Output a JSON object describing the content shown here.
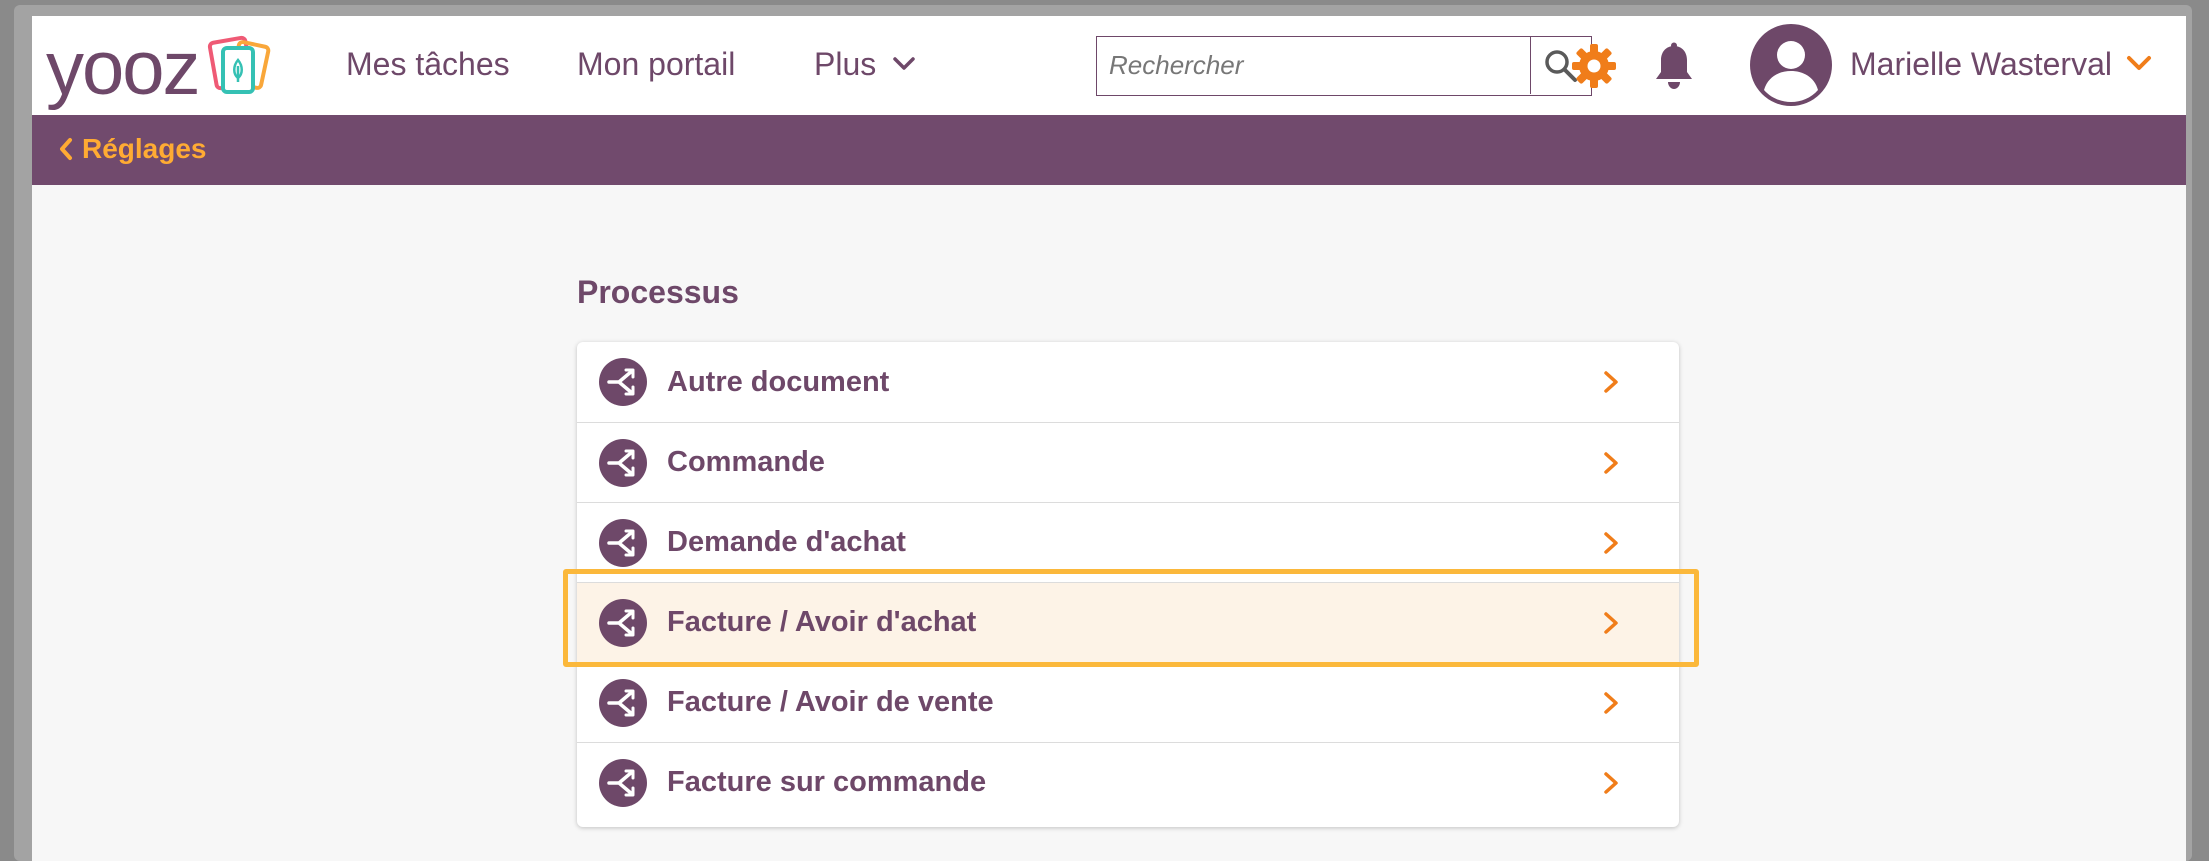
{
  "header": {
    "logo_text": "yooz",
    "nav": [
      "Mes tâches",
      "Mon portail",
      "Plus"
    ],
    "search_placeholder": "Rechercher",
    "user_name": "Marielle Wasterval"
  },
  "band": {
    "back_label": "Réglages"
  },
  "section": {
    "title": "Processus",
    "items": [
      {
        "label": "Autre document"
      },
      {
        "label": "Commande"
      },
      {
        "label": "Demande d'achat"
      },
      {
        "label": "Facture / Avoir d'achat"
      },
      {
        "label": "Facture / Avoir de vente"
      },
      {
        "label": "Facture sur commande"
      }
    ]
  },
  "icons": {
    "search": "search-icon",
    "settings": "gear-icon",
    "notifications": "bell-icon",
    "avatar": "user-avatar-icon",
    "process": "process-branch-icon",
    "chevron": "chevron-right-icon"
  },
  "colors": {
    "brand_purple": "#714a6d",
    "text_purple": "#6e4869",
    "accent_orange": "#f07d1a",
    "highlight": "#fbb83b"
  }
}
